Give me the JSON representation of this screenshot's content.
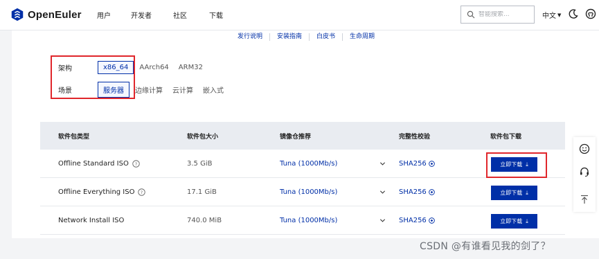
{
  "header": {
    "logo_text": "OpenEuler",
    "nav": [
      "用户",
      "开发者",
      "社区",
      "下载"
    ],
    "search_placeholder": "智能搜索...",
    "language": "中文"
  },
  "doc_links": [
    "发行说明",
    "安装指南",
    "白皮书",
    "生命周期"
  ],
  "filters": {
    "arch": {
      "label": "架构",
      "options": [
        "x86_64",
        "AArch64",
        "ARM32"
      ],
      "selected": "x86_64"
    },
    "scene": {
      "label": "场景",
      "options": [
        "服务器",
        "边缘计算",
        "云计算",
        "嵌入式"
      ],
      "selected": "服务器"
    }
  },
  "table": {
    "headers": [
      "软件包类型",
      "软件包大小",
      "镜像仓推荐",
      "完整性校验",
      "软件包下载"
    ],
    "rows": [
      {
        "name": "Offline Standard ISO",
        "size": "3.5 GiB",
        "mirror": "Tuna (1000Mb/s)",
        "checksum": "SHA256",
        "button": "立即下载"
      },
      {
        "name": "Offline Everything ISO",
        "size": "17.1 GiB",
        "mirror": "Tuna (1000Mb/s)",
        "checksum": "SHA256",
        "button": "立即下载"
      },
      {
        "name": "Network Install ISO",
        "size": "740.0 MiB",
        "mirror": "Tuna (1000Mb/s)",
        "checksum": "SHA256",
        "button": "立即下载"
      }
    ]
  },
  "watermark": "CSDN @有谁看见我的剑了？",
  "colors": {
    "accent": "#002fa7",
    "highlight_box": "#e0262b",
    "table_header_bg": "#e9ecf1"
  }
}
